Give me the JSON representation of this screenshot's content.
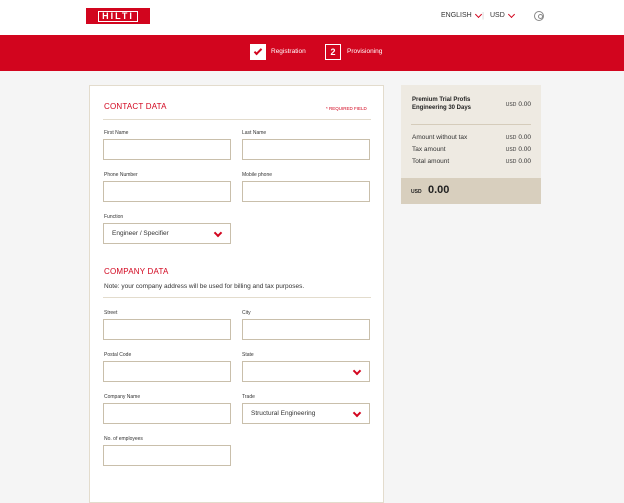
{
  "header": {
    "logo_text": "HILTI",
    "language": "ENGLISH",
    "currency": "USD"
  },
  "steps": [
    {
      "label": "Registration",
      "state": "done"
    },
    {
      "label": "Provisioning",
      "number": "2",
      "state": "active"
    }
  ],
  "contact": {
    "title": "CONTACT DATA",
    "required_note": "* REQUIRED FIELD",
    "first_name_label": "First Name",
    "last_name_label": "Last Name",
    "phone_label": "Phone Number",
    "mobile_label": "Mobile phone",
    "function_label": "Function",
    "function_value": "Engineer / Specifier"
  },
  "company": {
    "title": "COMPANY DATA",
    "note": "Note: your company address will be used for billing and tax purposes.",
    "street_label": "Street",
    "city_label": "City",
    "postal_label": "Postal Code",
    "state_label": "State",
    "state_value": "",
    "company_name_label": "Company Name",
    "trade_label": "Trade",
    "trade_value": "Structural Engineering",
    "employees_label": "No. of employees"
  },
  "summary": {
    "product": "Premium Trial Profis Engineering 30 Days",
    "product_currency": "USD",
    "product_price": "0.00",
    "rows": [
      {
        "label": "Amount without tax",
        "currency": "USD",
        "value": "0.00"
      },
      {
        "label": "Tax amount",
        "currency": "USD",
        "value": "0.00"
      },
      {
        "label": "Total amount",
        "currency": "USD",
        "value": "0.00"
      }
    ],
    "total_currency": "USD",
    "total_value": "0.00"
  },
  "colors": {
    "brand_red": "#d2051e",
    "summary_bg": "#eeeae2",
    "summary_total_bg": "#d8cfbe",
    "field_border": "#c9bfab"
  }
}
